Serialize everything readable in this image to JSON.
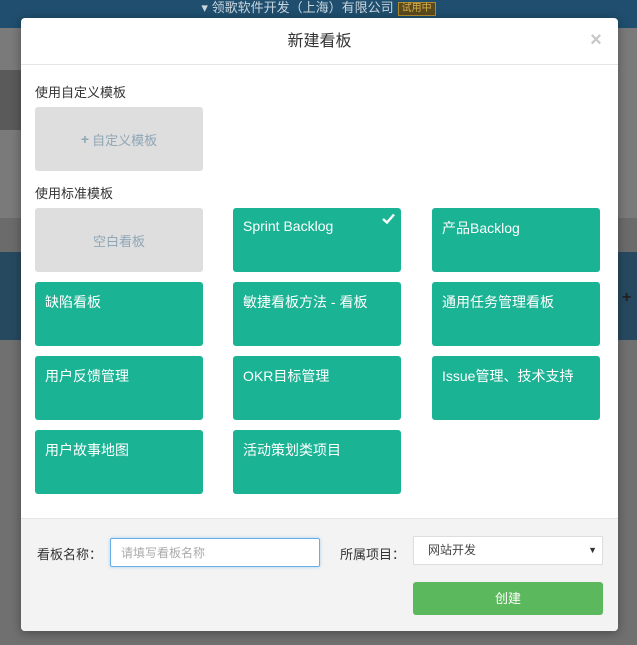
{
  "background": {
    "company": "领歌软件开发（上海）有限公司",
    "trial_badge": "试用中",
    "plus_glyph": "+"
  },
  "modal": {
    "title": "新建看板",
    "close_glyph": "×",
    "custom_section_label": "使用自定义模板",
    "custom_template_label": "自定义模板",
    "custom_template_plus": "+",
    "standard_section_label": "使用标准模板",
    "templates": [
      {
        "label": "空白看板",
        "style": "gray",
        "selected": false
      },
      {
        "label": "Sprint Backlog",
        "style": "green",
        "selected": true
      },
      {
        "label": "产品Backlog",
        "style": "green",
        "selected": false
      },
      {
        "label": "缺陷看板",
        "style": "green",
        "selected": false
      },
      {
        "label": "敏捷看板方法 - 看板",
        "style": "green",
        "selected": false
      },
      {
        "label": "通用任务管理看板",
        "style": "green",
        "selected": false
      },
      {
        "label": "用户反馈管理",
        "style": "green",
        "selected": false
      },
      {
        "label": "OKR目标管理",
        "style": "green",
        "selected": false
      },
      {
        "label": "Issue管理、技术支持",
        "style": "green",
        "selected": false
      },
      {
        "label": "用户故事地图",
        "style": "green",
        "selected": false
      },
      {
        "label": "活动策划类项目",
        "style": "green",
        "selected": false
      }
    ],
    "footer": {
      "name_label": "看板名称：",
      "name_value": "",
      "name_placeholder": "请填写看板名称",
      "project_label": "所属项目：",
      "project_value": "网站开发",
      "create_label": "创建"
    }
  },
  "colors": {
    "accent_green": "#1ab394",
    "button_green": "#5cb85c",
    "tile_gray": "#dedede"
  },
  "icons": {
    "close": "close-icon",
    "check": "check-icon",
    "plus": "plus-icon",
    "dropdown": "chevron-down-icon"
  }
}
